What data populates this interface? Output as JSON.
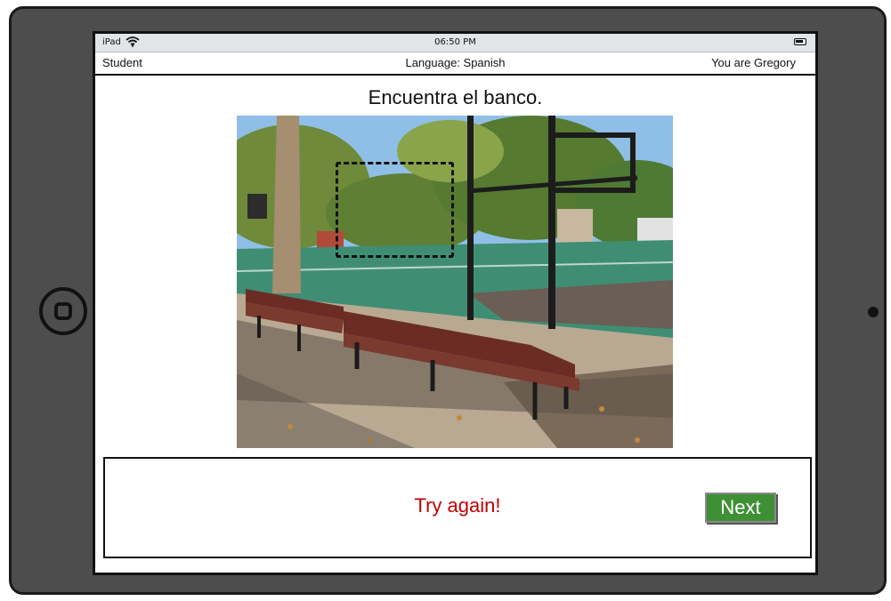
{
  "status_bar": {
    "device": "iPad",
    "time": "06:50 PM",
    "wifi_icon": "wifi-icon",
    "battery_icon": "battery-icon"
  },
  "header": {
    "role": "Student",
    "language": "Language: Spanish",
    "user": "You are Gregory"
  },
  "exercise": {
    "prompt": "Encuentra el banco.",
    "image_subject": "park benches photo"
  },
  "feedback": {
    "message": "Try again!",
    "message_color": "#c00000",
    "next_label": "Next",
    "next_color": "#3f8f35"
  }
}
